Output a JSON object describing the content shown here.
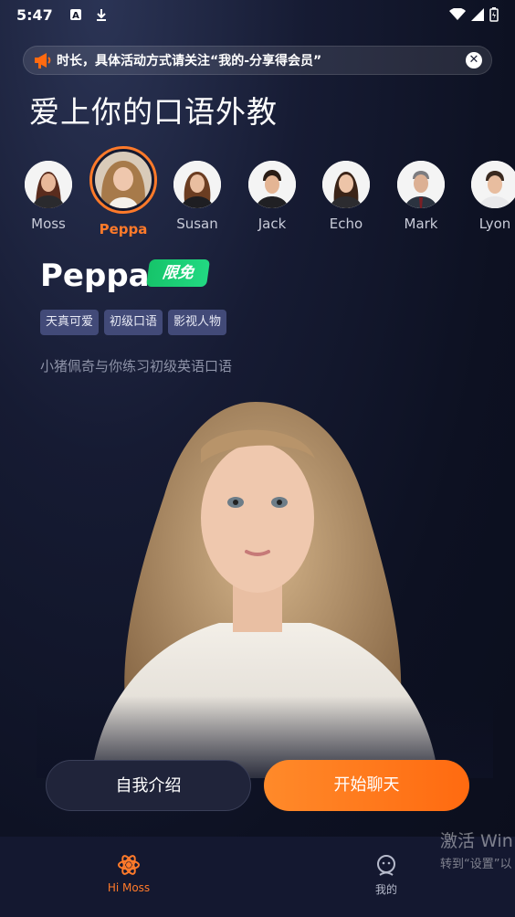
{
  "status_bar": {
    "time": "5:47"
  },
  "banner": {
    "text": "时长，具体活动方式请关注“我的-分享得会员”"
  },
  "page": {
    "title": "爱上你的口语外教"
  },
  "tutors": [
    {
      "name": "Moss",
      "selected": false
    },
    {
      "name": "Peppa",
      "selected": true
    },
    {
      "name": "Susan",
      "selected": false
    },
    {
      "name": "Jack",
      "selected": false
    },
    {
      "name": "Echo",
      "selected": false
    },
    {
      "name": "Mark",
      "selected": false
    },
    {
      "name": "Lyon",
      "selected": false
    }
  ],
  "selected_tutor": {
    "name": "Peppa",
    "badge": "限免",
    "tags": [
      "天真可爱",
      "初级口语",
      "影视人物"
    ],
    "description": "小猪佩奇与你练习初级英语口语"
  },
  "actions": {
    "intro_label": "自我介绍",
    "chat_label": "开始聊天"
  },
  "bottom_nav": [
    {
      "label": "Hi Moss",
      "icon": "atom-icon",
      "active": true
    },
    {
      "label": "我的",
      "icon": "profile-icon",
      "active": false
    }
  ],
  "watermark": {
    "line1": "激活 Win",
    "line2": "转到“设置”以"
  },
  "colors": {
    "accent": "#ff7a2a",
    "badge_green": "#1ecf75",
    "tag_bg": "#424a78"
  }
}
